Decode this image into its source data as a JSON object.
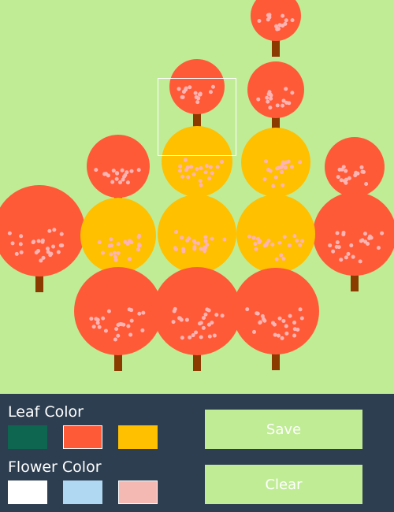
{
  "colors": {
    "ground": "#c0ec96",
    "panel_bg": "#2d3e50",
    "trunk": "#8b3a00",
    "button_bg": "#c0ec96",
    "button_text": "#ffffff",
    "selection_outline": "#ffffff",
    "swatch_selected_border": "#ffffff"
  },
  "canvas": {
    "selection_visible": true
  },
  "trees": [
    {
      "leaf": "#ff5a37",
      "flower": "#ffb4b4"
    },
    {
      "leaf": "#ff5a37",
      "flower": "#ffb4b4"
    },
    {
      "leaf": "#ff5a37",
      "flower": "#ffb4b4"
    },
    {
      "leaf": "#ff5a37",
      "flower": "#ffb4b4"
    },
    {
      "leaf": "#ff5a37",
      "flower": "#ffb4b4"
    },
    {
      "leaf": "#ff5a37",
      "flower": "#ffb4b4"
    },
    {
      "leaf": "#ff5a37",
      "flower": "#ffb4b4"
    },
    {
      "leaf": "#ffc000",
      "flower": "#ffb4b4"
    },
    {
      "leaf": "#ffc000",
      "flower": "#ffb4b4"
    },
    {
      "leaf": "#ffc000",
      "flower": "#ffb4b4"
    },
    {
      "leaf": "#ffc000",
      "flower": "#ffb4b4"
    },
    {
      "leaf": "#ffc000",
      "flower": "#ffb4b4"
    },
    {
      "leaf": "#ff5a37",
      "flower": "#ffb4b4"
    },
    {
      "leaf": "#ff5a37",
      "flower": "#ffb4b4"
    },
    {
      "leaf": "#ff5a37",
      "flower": "#ffb4b4"
    },
    {
      "leaf": "#ff5a37",
      "flower": "#ffb4b4"
    }
  ],
  "panel": {
    "leaf_label": "Leaf Color",
    "flower_label": "Flower Color",
    "leaf_colors": [
      {
        "name": "dark-green",
        "hex": "#0f6650",
        "selected": false
      },
      {
        "name": "red-orange",
        "hex": "#ff5a37",
        "selected": true
      },
      {
        "name": "amber",
        "hex": "#ffc000",
        "selected": false
      }
    ],
    "flower_colors": [
      {
        "name": "white",
        "hex": "#ffffff",
        "selected": false
      },
      {
        "name": "light-blue",
        "hex": "#b0d8f2",
        "selected": false
      },
      {
        "name": "pink",
        "hex": "#f5b9b4",
        "selected": true
      }
    ],
    "save_label": "Save",
    "clear_label": "Clear"
  }
}
